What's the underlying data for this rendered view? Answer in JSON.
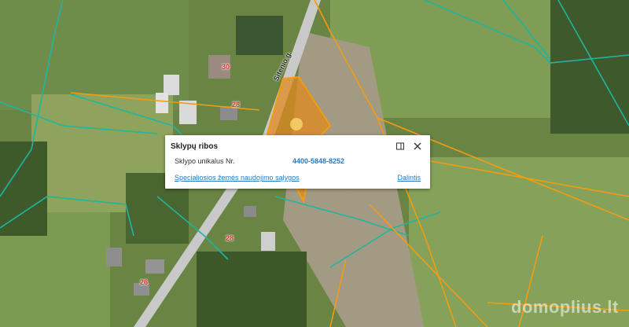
{
  "map": {
    "street_name": "Sitenio g.",
    "house_numbers": [
      "30",
      "28",
      "28",
      "26"
    ],
    "colors": {
      "parcel_border": "#f39c12",
      "cadastral_line": "#1fb5a0",
      "selected_fill": "#e08a1e",
      "road": "#c9c9c9"
    }
  },
  "popup": {
    "title": "Sklypų ribos",
    "row_label": "Sklypo unikalus Nr.",
    "row_value": "4400-5848-8252",
    "link_text": "Specialiosios žemės naudojimo sąlygos",
    "share_text": "Dalintis",
    "dock_icon": "dock-icon",
    "close_icon": "close-icon"
  },
  "watermark": "domoplius.lt"
}
